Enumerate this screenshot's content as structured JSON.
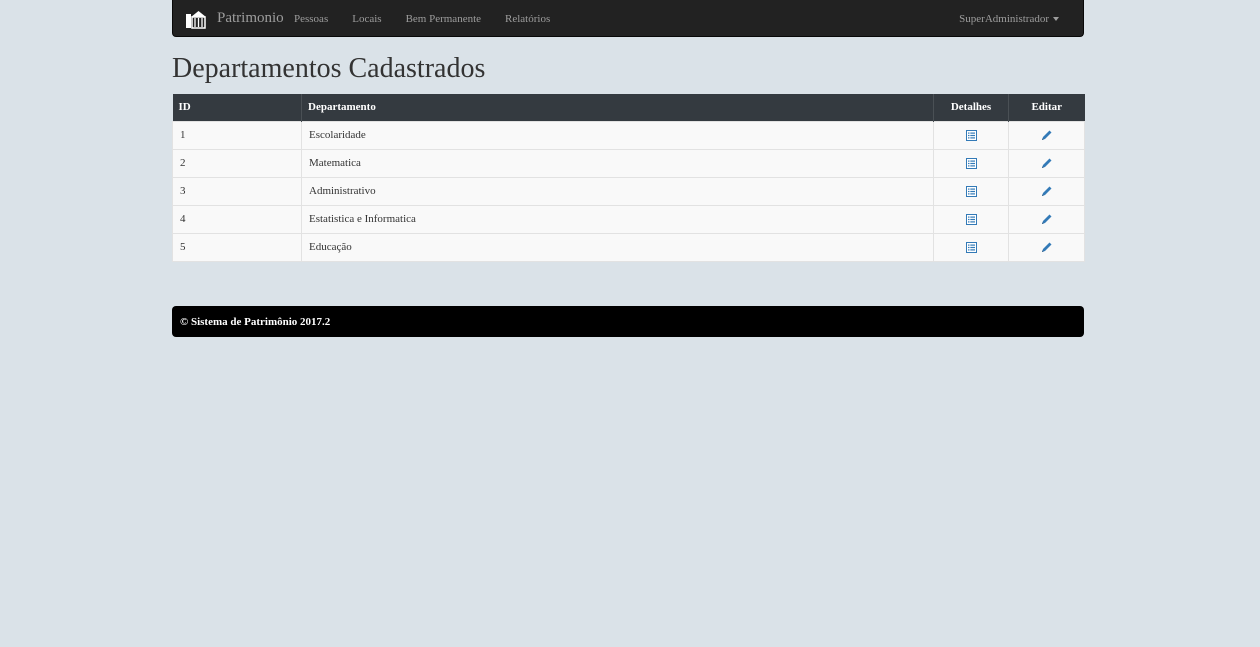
{
  "navbar": {
    "brand": "Patrimonio",
    "links": [
      "Pessoas",
      "Locais",
      "Bem Permanente",
      "Relatórios"
    ],
    "user": "SuperAdministrador"
  },
  "page": {
    "title": "Departamentos Cadastrados"
  },
  "table": {
    "headers": {
      "id": "ID",
      "department": "Departamento",
      "details": "Detalhes",
      "edit": "Editar"
    },
    "rows": [
      {
        "id": "1",
        "department": "Escolaridade"
      },
      {
        "id": "2",
        "department": "Matematica"
      },
      {
        "id": "3",
        "department": "Administrativo"
      },
      {
        "id": "4",
        "department": "Estatistica e Informatica"
      },
      {
        "id": "5",
        "department": "Educação"
      }
    ]
  },
  "footer": {
    "text": "© Sistema de Patrimônio 2017.2"
  },
  "colors": {
    "background": "#dae2e8",
    "navbar": "#222222",
    "table_header": "#343a40",
    "footer": "#000000",
    "icon_blue": "#337ab7"
  }
}
